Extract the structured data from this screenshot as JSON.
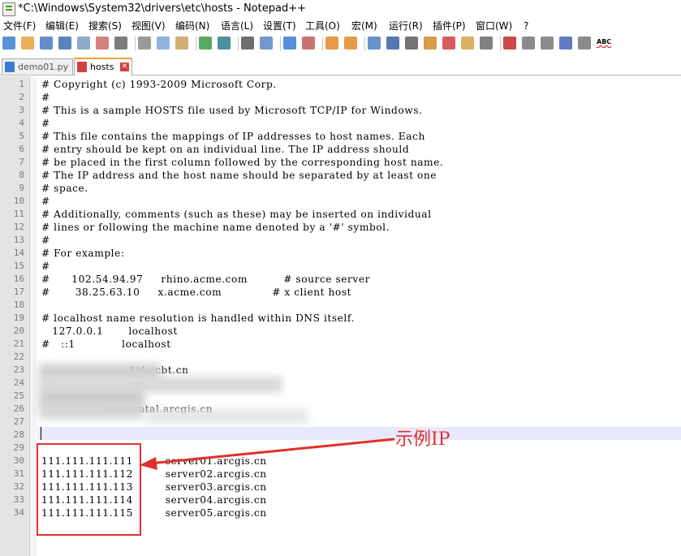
{
  "window": {
    "title": "*C:\\Windows\\System32\\drivers\\etc\\hosts - Notepad++",
    "app_icon": "notepadpp-icon"
  },
  "menu": [
    "文件(F)",
    "编辑(E)",
    "搜索(S)",
    "视图(V)",
    "编码(N)",
    "语言(L)",
    "设置(T)",
    "工具(O)",
    "宏(M)",
    "运行(R)",
    "插件(P)",
    "窗口(W)",
    "?"
  ],
  "toolbar": {
    "icons": [
      "new-file-icon",
      "open-file-icon",
      "save-icon",
      "save-all-icon",
      "close-icon",
      "close-all-icon",
      "print-icon",
      "cut-icon",
      "copy-icon",
      "paste-icon",
      "undo-icon",
      "redo-icon",
      "find-icon",
      "replace-icon",
      "zoom-in-icon",
      "zoom-out-icon",
      "sync-vertical-icon",
      "sync-horizontal-icon",
      "word-wrap-icon",
      "show-all-chars-icon",
      "indent-guide-icon",
      "doc-map-icon",
      "function-list-icon",
      "folder-workspace-icon",
      "monitoring-icon",
      "record-macro-icon",
      "stop-macro-icon",
      "play-macro-icon",
      "run-macro-multiple-icon",
      "save-macro-icon",
      "spell-check-icon"
    ],
    "spellcheck_label": "ABC"
  },
  "tabs": [
    {
      "label": "demo01.py",
      "active": false,
      "close": "✕"
    },
    {
      "label": "hosts",
      "active": true,
      "close": "✕"
    }
  ],
  "colors": {
    "accent_red": "#e0302b",
    "current_line": "#e8e8ff",
    "gutter": "#e4e4e4"
  },
  "editor": {
    "lines": [
      {
        "n": "1",
        "text": "# Copyright (c) 1993-2009 Microsoft Corp."
      },
      {
        "n": "2",
        "text": "#"
      },
      {
        "n": "3",
        "text": "# This is a sample HOSTS file used by Microsoft TCP/IP for Windows."
      },
      {
        "n": "4",
        "text": "#"
      },
      {
        "n": "5",
        "text": "# This file contains the mappings of IP addresses to host names. Each"
      },
      {
        "n": "6",
        "text": "# entry should be kept on an individual line. The IP address should"
      },
      {
        "n": "7",
        "text": "# be placed in the first column followed by the corresponding host name."
      },
      {
        "n": "8",
        "text": "# The IP address and the host name should be separated by at least one"
      },
      {
        "n": "9",
        "text": "# space."
      },
      {
        "n": "10",
        "text": "#"
      },
      {
        "n": "11",
        "text": "# Additionally, comments (such as these) may be inserted on individual"
      },
      {
        "n": "12",
        "text": "# lines or following the machine name denoted by a '#' symbol."
      },
      {
        "n": "13",
        "text": "#"
      },
      {
        "n": "14",
        "text": "# For example:"
      },
      {
        "n": "15",
        "text": "#"
      },
      {
        "n": "16",
        "text": "#      102.54.94.97     rhino.acme.com          # source server"
      },
      {
        "n": "17",
        "text": "#       38.25.63.10     x.acme.com              # x client host"
      },
      {
        "n": "18",
        "text": ""
      },
      {
        "n": "19",
        "text": "# localhost name resolution is handled within DNS itself."
      },
      {
        "n": "20",
        "text": "   127.0.0.1       localhost"
      },
      {
        "n": "21",
        "text": "#   ::1             localhost"
      },
      {
        "n": "22",
        "text": ""
      },
      {
        "n": "23",
        "text": "                         tal.ccbt.cn"
      },
      {
        "n": "24",
        "text": ""
      },
      {
        "n": "25",
        "text": ""
      },
      {
        "n": "26",
        "text": "                 mmmental.arcgis.cn"
      },
      {
        "n": "27",
        "text": ""
      },
      {
        "n": "28",
        "text": ""
      },
      {
        "n": "29",
        "text": ""
      },
      {
        "n": "30",
        "text": "111.111.111.111         server01.arcgis.cn"
      },
      {
        "n": "31",
        "text": "111.111.111.112         server02.arcgis.cn"
      },
      {
        "n": "32",
        "text": "111.111.111.113         server03.arcgis.cn"
      },
      {
        "n": "33",
        "text": "111.111.111.114         server04.arcgis.cn"
      },
      {
        "n": "34",
        "text": "111.111.111.115         server05.arcgis.cn"
      }
    ]
  },
  "annotation": {
    "label": "示例IP"
  }
}
